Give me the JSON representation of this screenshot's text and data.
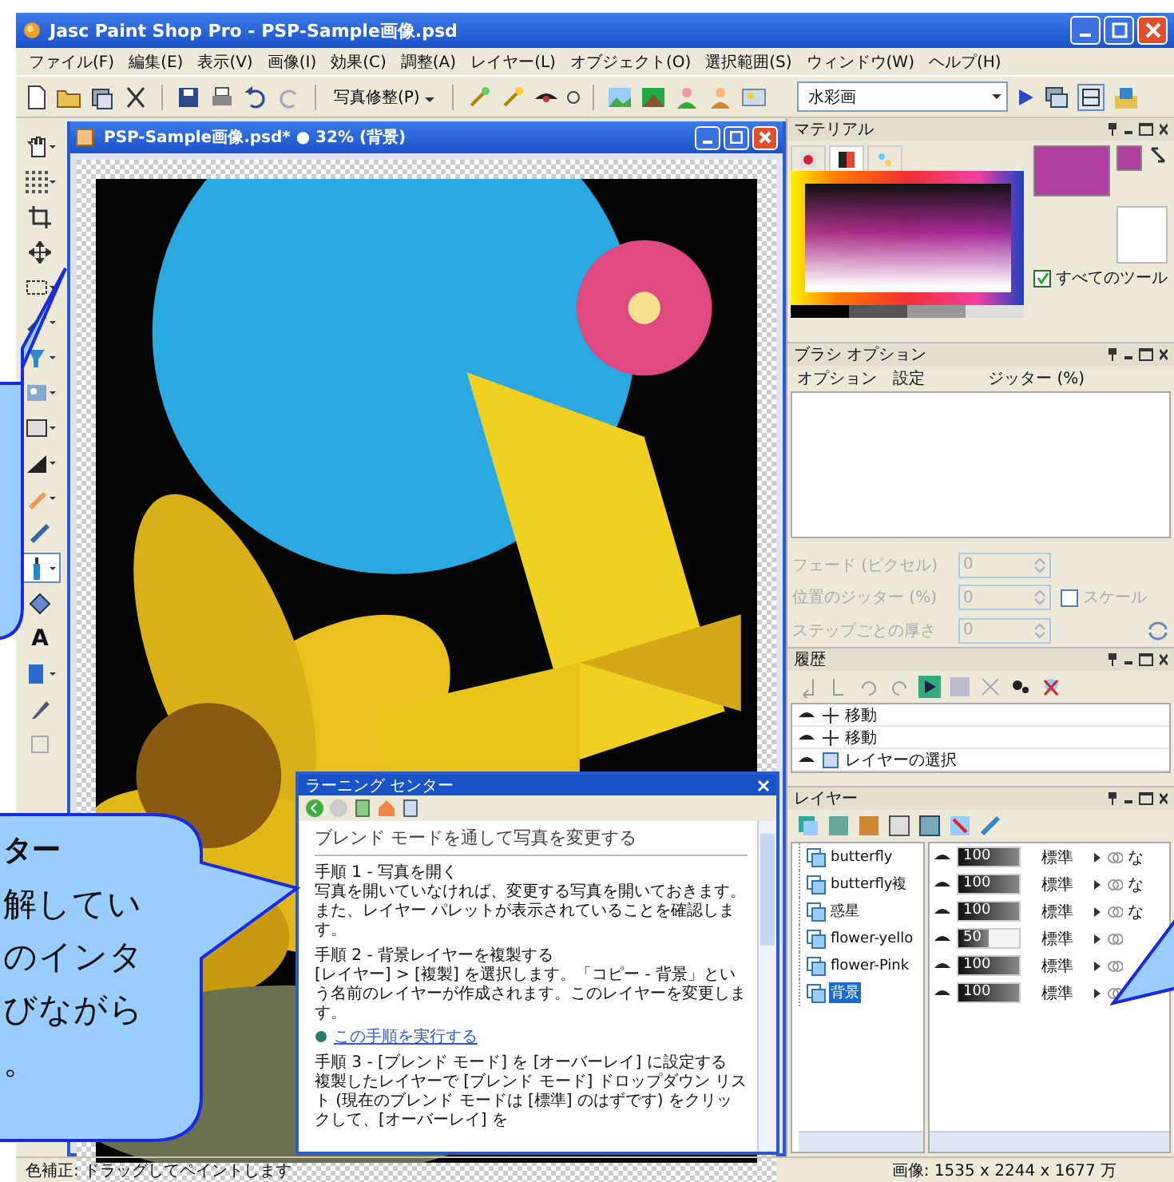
{
  "window": {
    "title": "Jasc Paint Shop Pro - PSP-Sample画像.psd"
  },
  "menu": [
    "ファイル(F)",
    "編集(E)",
    "表示(V)",
    "画像(I)",
    "効果(C)",
    "調整(A)",
    "レイヤー(L)",
    "オブジェクト(O)",
    "選択範囲(S)",
    "ウィンドウ(W)",
    "ヘルプ(H)"
  ],
  "toolbar": {
    "preset_button": "写真修整(P)",
    "preset_combo": "水彩画"
  },
  "tools": [
    {
      "kind": "pan",
      "dropdown": true,
      "selected": false
    },
    {
      "kind": "grid",
      "dropdown": true,
      "selected": false
    },
    {
      "kind": "crop",
      "dropdown": false,
      "selected": false
    },
    {
      "kind": "move",
      "dropdown": false,
      "selected": false
    },
    {
      "kind": "selection",
      "dropdown": true,
      "selected": false
    },
    {
      "kind": "dropper",
      "dropdown": true,
      "selected": false
    },
    {
      "kind": "clone",
      "dropdown": true,
      "selected": false
    },
    {
      "kind": "tube",
      "dropdown": true,
      "selected": false
    },
    {
      "kind": "rectangle",
      "dropdown": true,
      "selected": false
    },
    {
      "kind": "fill",
      "dropdown": true,
      "selected": false
    },
    {
      "kind": "eraser",
      "dropdown": true,
      "selected": false
    },
    {
      "kind": "brush",
      "dropdown": false,
      "selected": false
    },
    {
      "kind": "bottle",
      "dropdown": true,
      "selected": true
    },
    {
      "kind": "diamond",
      "dropdown": false,
      "selected": false
    },
    {
      "kind": "text",
      "glyph": "A",
      "dropdown": false,
      "selected": false
    },
    {
      "kind": "shape",
      "dropdown": true,
      "selected": false
    },
    {
      "kind": "pen",
      "dropdown": false,
      "selected": false
    },
    {
      "kind": "frame",
      "dropdown": false,
      "selected": false
    }
  ],
  "document": {
    "title": "PSP-Sample画像.psd* ● 32% (背景)"
  },
  "learning_center": {
    "title": "ラーニング センター",
    "heading": "ブレンド モードを通して写真を変更する",
    "steps": [
      {
        "title": "手順 1 - 写真を開く",
        "text": "写真を開いていなければ、変更する写真を開いておきます。また、レイヤー パレットが表示されていることを確認します。"
      },
      {
        "title": "手順 2 - 背景レイヤーを複製する",
        "text": "[レイヤー] > [複製] を選択します。「コピー - 背景」という名前のレイヤーが作成されます。このレイヤーを変更します。",
        "link": "この手順を実行する"
      },
      {
        "title": "手順 3 - [ブレンド モード] を [オーバーレイ] に設定する",
        "text": "複製したレイヤーで [ブレンド モード] ドロップダウン リスト (現在のブレンド モードは [標準] のはずです) をクリックして、[オーバーレイ] を"
      }
    ]
  },
  "materials": {
    "title": "マテリアル",
    "all_tools": {
      "label": "すべてのツール",
      "checked": true
    }
  },
  "brush_options": {
    "title": "ブラシ オプション",
    "columns": [
      "オプション",
      "設定",
      "ジッター (%)"
    ],
    "disabled": true,
    "fields": [
      {
        "label": "フェード (ピクセル)",
        "value": "0"
      },
      {
        "label": "位置のジッター (%)",
        "value": "0"
      },
      {
        "label": "ステップごとの厚さ",
        "value": "0"
      }
    ],
    "scale": {
      "label": "スケール",
      "checked": false
    }
  },
  "history": {
    "title": "履歴",
    "items": [
      {
        "kind": "move",
        "label": "移動"
      },
      {
        "kind": "move",
        "label": "移動"
      },
      {
        "kind": "layer",
        "label": "レイヤーの選択"
      }
    ]
  },
  "layers": {
    "title": "レイヤー",
    "items": [
      {
        "name": "butterfly",
        "opacity": "100",
        "level": 1,
        "blend": "標準",
        "link": "な",
        "selected": false
      },
      {
        "name": "butterfly複",
        "opacity": "100",
        "level": 1,
        "blend": "標準",
        "link": "な",
        "selected": false
      },
      {
        "name": "惑星",
        "opacity": "100",
        "level": 1,
        "blend": "標準",
        "link": "な",
        "selected": false
      },
      {
        "name": "flower-yello",
        "opacity": "50",
        "level": 0.5,
        "blend": "標準",
        "selected": false
      },
      {
        "name": "flower-Pink",
        "opacity": "100",
        "level": 1,
        "blend": "標準",
        "selected": false
      },
      {
        "name": "背景",
        "opacity": "100",
        "level": 1,
        "blend": "標準",
        "selected": true
      }
    ]
  },
  "status_bar": {
    "hint": "色補正: ドラッグしてペイントします",
    "info": "画像: 1535 x 2244 x 1677 万"
  },
  "callout": {
    "heading": "ター",
    "lines": [
      "解してい",
      "のインタ",
      "びながら",
      "。"
    ]
  }
}
